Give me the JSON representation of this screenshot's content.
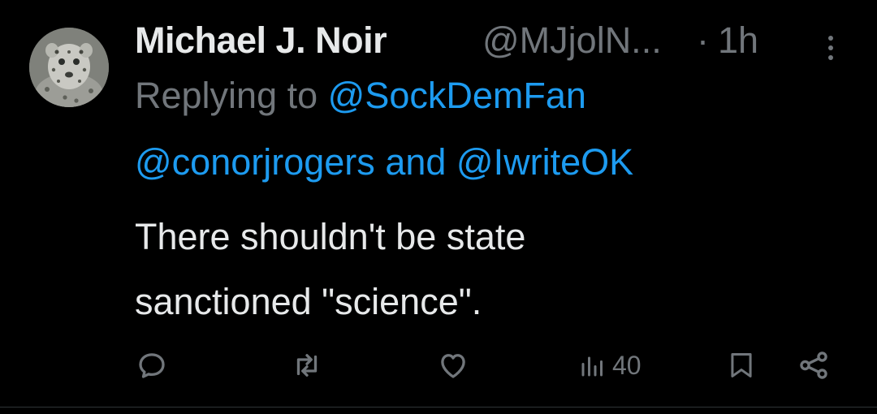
{
  "tweet": {
    "author_name": "Michael J. Noir",
    "author_handle": "@MJjolN...",
    "separator": "·",
    "timestamp": "1h",
    "replying_prefix": "Replying to",
    "mentions": [
      "@SockDemFan",
      "@conorjrogers",
      "@IwriteOK"
    ],
    "mention_joiner": "and",
    "body_line1": "There shouldn't be state",
    "body_line2": "sanctioned \"science\"."
  },
  "actions": {
    "reply_icon": "comment-bubble-icon",
    "retweet_icon": "retweet-arrows-icon",
    "like_icon": "heart-outline-icon",
    "views_icon": "bar-chart-icon",
    "views_count": "40",
    "bookmark_icon": "bookmark-outline-icon",
    "share_icon": "share-nodes-icon"
  },
  "colors": {
    "background": "#000000",
    "primary_text": "#e7e9ea",
    "secondary_text": "#71767b",
    "link": "#1d9bf0"
  }
}
